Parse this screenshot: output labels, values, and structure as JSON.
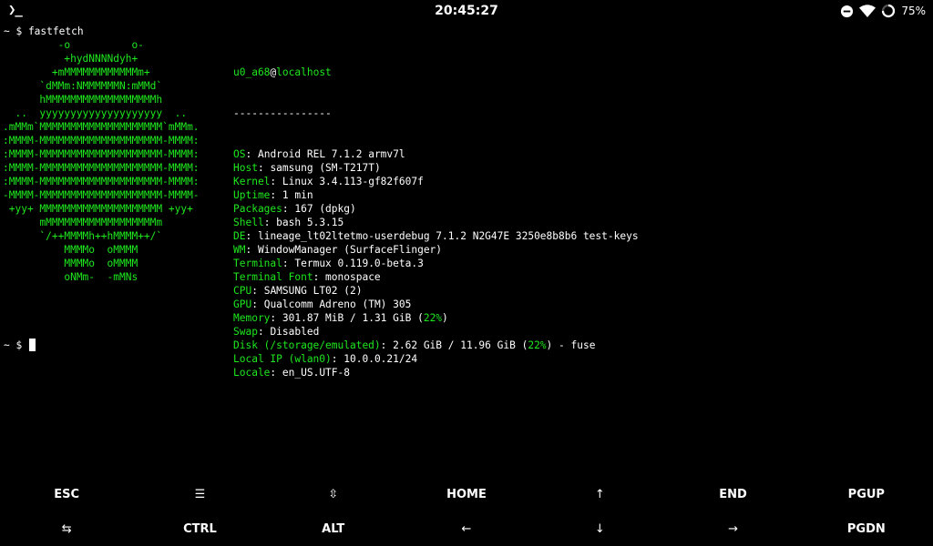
{
  "statusbar": {
    "clock": "20:45:27",
    "battery": "75%",
    "battery_level": 0.75
  },
  "terminal": {
    "command_prompt": "~ $ fastfetch",
    "logo_lines": [
      "         -o          o-",
      "          +hydNNNNdyh+",
      "        +mMMMMMMMMMMMMm+",
      "      `dMMm:NMMMMMMN:mMMd`",
      "      hMMMMMMMMMMMMMMMMMMh",
      "  ..  yyyyyyyyyyyyyyyyyyyy  ..",
      ".mMMm`MMMMMMMMMMMMMMMMMMMM`mMMm.",
      ":MMMM-MMMMMMMMMMMMMMMMMMMM-MMMM:",
      ":MMMM-MMMMMMMMMMMMMMMMMMMM-MMMM:",
      ":MMMM-MMMMMMMMMMMMMMMMMMMM-MMMM:",
      ":MMMM-MMMMMMMMMMMMMMMMMMMM-MMMM:",
      "-MMMM-MMMMMMMMMMMMMMMMMMMM-MMMM-",
      " +yy+ MMMMMMMMMMMMMMMMMMMM +yy+",
      "      mMMMMMMMMMMMMMMMMMMm",
      "      `/++MMMMh++hMMMM++/`",
      "          MMMMo  oMMMM",
      "          MMMMo  oMMMM",
      "          oNMm-  -mMNs"
    ],
    "user": "u0_a68",
    "at": "@",
    "host": "localhost",
    "separator": "----------------",
    "info": [
      {
        "key": "OS",
        "value": "Android REL 7.1.2 armv7l"
      },
      {
        "key": "Host",
        "value": "samsung (SM-T217T)"
      },
      {
        "key": "Kernel",
        "value": "Linux 3.4.113-gf82f607f"
      },
      {
        "key": "Uptime",
        "value": "1 min"
      },
      {
        "key": "Packages",
        "value": "167 (dpkg)"
      },
      {
        "key": "Shell",
        "value": "bash 5.3.15"
      },
      {
        "key": "DE",
        "value": "lineage_lt02ltetmo-userdebug 7.1.2 N2G47E 3250e8b8b6 test-keys"
      },
      {
        "key": "WM",
        "value": "WindowManager (SurfaceFlinger)"
      },
      {
        "key": "Terminal",
        "value": "Termux 0.119.0-beta.3"
      },
      {
        "key": "Terminal Font",
        "value": "monospace"
      },
      {
        "key": "CPU",
        "value": "SAMSUNG LT02 (2)"
      },
      {
        "key": "GPU",
        "value": "Qualcomm Adreno (TM) 305"
      },
      {
        "key": "Memory",
        "value": "301.87 MiB / 1.31 GiB (",
        "pct": "22%",
        "tail": ")"
      },
      {
        "key": "Swap",
        "value": "Disabled"
      },
      {
        "key": "Disk (/storage/emulated)",
        "value": "2.62 GiB / 11.96 GiB (",
        "pct": "22%",
        "tail": ") - fuse"
      },
      {
        "key": "Local IP (wlan0)",
        "value": "10.0.0.21/24"
      },
      {
        "key": "Locale",
        "value": "en_US.UTF-8"
      }
    ],
    "prompt": "~ $ "
  },
  "extrakeys": {
    "row1": [
      {
        "id": "esc",
        "label": "ESC"
      },
      {
        "id": "menu",
        "label": "☰"
      },
      {
        "id": "shift",
        "label": "⇳"
      },
      {
        "id": "home",
        "label": "HOME"
      },
      {
        "id": "up",
        "label": "↑"
      },
      {
        "id": "end",
        "label": "END"
      },
      {
        "id": "pgup",
        "label": "PGUP"
      }
    ],
    "row2": [
      {
        "id": "tab",
        "label": "⇆"
      },
      {
        "id": "ctrl",
        "label": "CTRL"
      },
      {
        "id": "alt",
        "label": "ALT"
      },
      {
        "id": "left",
        "label": "←"
      },
      {
        "id": "down",
        "label": "↓"
      },
      {
        "id": "right",
        "label": "→"
      },
      {
        "id": "pgdn",
        "label": "PGDN"
      }
    ]
  }
}
